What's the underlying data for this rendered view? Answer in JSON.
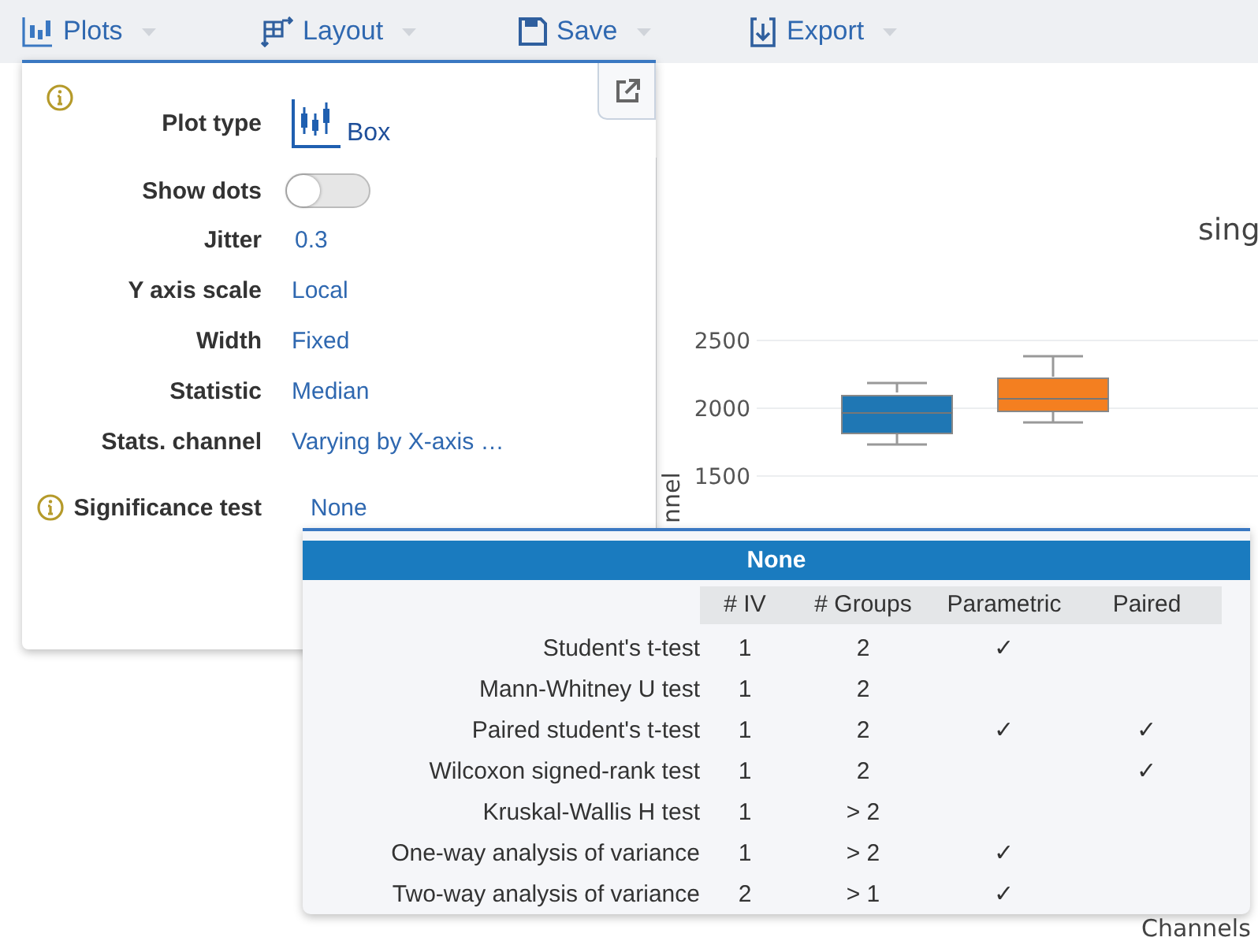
{
  "toolbar": [
    {
      "label": "Plots"
    },
    {
      "label": "Layout"
    },
    {
      "label": "Save"
    },
    {
      "label": "Export"
    }
  ],
  "chart": {
    "title": "sing",
    "ylabel": "nnel",
    "xlabel": "Channels",
    "yticks": [
      "2500",
      "2000",
      "1500"
    ]
  },
  "settings": {
    "rows": [
      {
        "kind": "plot-type",
        "label": "Plot type",
        "value": "Box"
      },
      {
        "kind": "toggle",
        "label": "Show dots",
        "on": false
      },
      {
        "kind": "input",
        "label": "Jitter",
        "value": "0.3"
      },
      {
        "kind": "select",
        "label": "Y axis scale",
        "value": "Local"
      },
      {
        "kind": "select",
        "label": "Width",
        "value": "Fixed"
      },
      {
        "kind": "select",
        "label": "Statistic",
        "value": "Median"
      },
      {
        "kind": "select",
        "label": "Stats. channel",
        "value": "Varying by X-axis …"
      },
      {
        "kind": "test",
        "label": "Significance test",
        "value": "None"
      }
    ]
  },
  "significance_dropdown": {
    "selected_option": "None",
    "columns": [
      "# IV",
      "# Groups",
      "Parametric",
      "Paired"
    ],
    "check_mark": "✓",
    "rows": [
      {
        "name": "Student's t-test",
        "iv": "1",
        "groups": "2",
        "parametric": true,
        "paired": false
      },
      {
        "name": "Mann-Whitney U test",
        "iv": "1",
        "groups": "2",
        "parametric": false,
        "paired": false
      },
      {
        "name": "Paired student's t-test",
        "iv": "1",
        "groups": "2",
        "parametric": true,
        "paired": true
      },
      {
        "name": "Wilcoxon signed-rank test",
        "iv": "1",
        "groups": "2",
        "parametric": false,
        "paired": true
      },
      {
        "name": "Kruskal-Wallis H test",
        "iv": "1",
        "groups": "> 2",
        "parametric": false,
        "paired": false
      },
      {
        "name": "One-way analysis of variance",
        "iv": "1",
        "groups": "> 2",
        "parametric": true,
        "paired": false
      },
      {
        "name": "Two-way analysis of variance",
        "iv": "2",
        "groups": "> 1",
        "parametric": true,
        "paired": false
      }
    ]
  }
}
